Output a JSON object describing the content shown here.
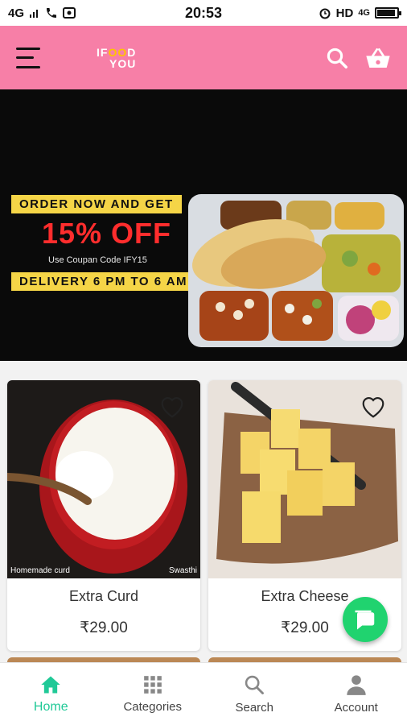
{
  "status_bar": {
    "network": "4G",
    "time": "20:53",
    "hd": "HD",
    "network_right": "4G",
    "battery_level": 0.9
  },
  "app_bar": {
    "logo_line1_a": "IF",
    "logo_line1_b": "OO",
    "logo_line1_c": "D",
    "logo_line2": "YOU",
    "menu_icon": "hamburger-icon",
    "search_icon": "search-icon",
    "cart_icon": "basket-icon"
  },
  "banner": {
    "line1": "ORDER NOW AND GET",
    "discount": "15% OFF",
    "code_text": "Use Coupan Code IFY15",
    "line2": "DELIVERY 6 PM TO 6 AM"
  },
  "products": [
    {
      "name": "Extra Curd",
      "price": "₹29.00",
      "caption_left": "Homemade curd",
      "caption_right": "Swasthi"
    },
    {
      "name": "Extra Cheese",
      "price": "₹29.00"
    }
  ],
  "bottom_nav": [
    {
      "label": "Home",
      "icon": "home-icon",
      "active": true
    },
    {
      "label": "Categories",
      "icon": "grid-icon",
      "active": false
    },
    {
      "label": "Search",
      "icon": "search-icon",
      "active": false
    },
    {
      "label": "Account",
      "icon": "person-icon",
      "active": false
    }
  ],
  "colors": {
    "app_bar": "#f77fa7",
    "accent": "#20c997",
    "fab": "#20d36f",
    "promo_yellow": "#f5d547",
    "promo_red": "#ff2d2d"
  }
}
